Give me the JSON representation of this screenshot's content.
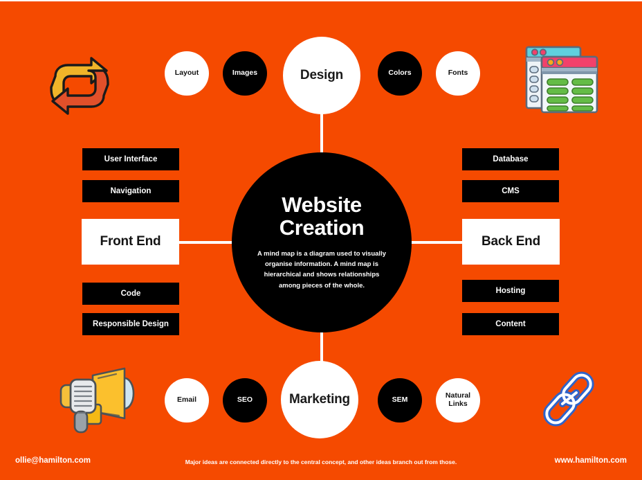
{
  "theme": {
    "background": "#F54A00",
    "ink_dark": "#000000",
    "ink_light": "#FFFFFF"
  },
  "center": {
    "title_line1": "Website",
    "title_line2": "Creation",
    "description": "A mind map is a diagram used to visually organise information. A mind map is hierarchical and shows relationships among pieces of the whole."
  },
  "branches": {
    "top": {
      "label": "Design",
      "children": [
        {
          "label": "Layout",
          "style": "white"
        },
        {
          "label": "Images",
          "style": "black"
        },
        {
          "label": "Colors",
          "style": "black"
        },
        {
          "label": "Fonts",
          "style": "white"
        }
      ]
    },
    "bottom": {
      "label": "Marketing",
      "children": [
        {
          "label": "Email",
          "style": "white"
        },
        {
          "label": "SEO",
          "style": "black"
        },
        {
          "label": "SEM",
          "style": "black"
        },
        {
          "label": "Natural Links",
          "style": "white"
        }
      ]
    },
    "left": {
      "label": "Front End",
      "above": [
        {
          "label": "User Interface"
        },
        {
          "label": "Navigation"
        }
      ],
      "below": [
        {
          "label": "Code"
        },
        {
          "label": "Responsible Design"
        }
      ]
    },
    "right": {
      "label": "Back End",
      "above": [
        {
          "label": "Database"
        },
        {
          "label": "CMS"
        }
      ],
      "below": [
        {
          "label": "Hosting"
        },
        {
          "label": "Content"
        }
      ]
    }
  },
  "decorations": [
    {
      "name": "refresh-cycle-icon",
      "corner": "top-left"
    },
    {
      "name": "browser-windows-icon",
      "corner": "top-right"
    },
    {
      "name": "megaphone-icon",
      "corner": "bottom-left"
    },
    {
      "name": "chain-link-icon",
      "corner": "bottom-right"
    }
  ],
  "footer": {
    "email": "ollie@hamilton.com",
    "tagline": "Major ideas are connected directly to the central concept, and other ideas branch out from those.",
    "website": "www.hamilton.com"
  }
}
